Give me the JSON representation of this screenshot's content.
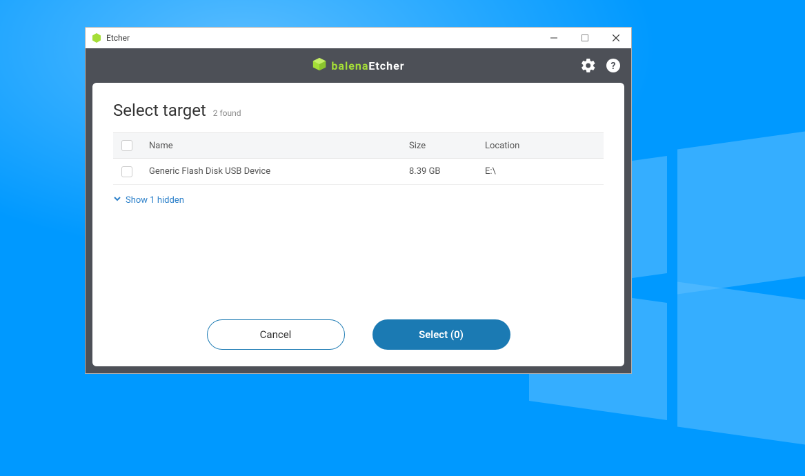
{
  "window": {
    "title": "Etcher"
  },
  "brand": {
    "name1": "balena",
    "name2": "Etcher"
  },
  "panel": {
    "title": "Select target",
    "found_label": "2 found"
  },
  "table": {
    "headers": {
      "name": "Name",
      "size": "Size",
      "location": "Location"
    },
    "rows": [
      {
        "name": "Generic Flash Disk USB Device",
        "size": "8.39 GB",
        "location": "E:\\"
      }
    ]
  },
  "show_hidden": "Show 1 hidden",
  "buttons": {
    "cancel": "Cancel",
    "select": "Select (0)"
  }
}
